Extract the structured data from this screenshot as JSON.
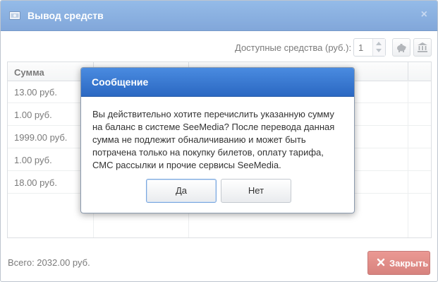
{
  "window": {
    "title": "Вывод средств",
    "close_glyph": "×",
    "icon": "money-icon"
  },
  "toolbar": {
    "available_label": "Доступные средства (руб.):",
    "available_value": "1",
    "btn1_icon": "piggy-bank-icon",
    "btn2_icon": "bank-icon"
  },
  "grid": {
    "columns": [
      "Сумма",
      "",
      ""
    ],
    "rows": [
      [
        "13.00 руб.",
        "",
        ""
      ],
      [
        "1.00 руб.",
        "",
        ""
      ],
      [
        "1999.00 руб.",
        "",
        ""
      ],
      [
        "1.00 руб.",
        "",
        ""
      ],
      [
        "18.00 руб.",
        "",
        ""
      ]
    ]
  },
  "footer": {
    "total": "Всего: 2032.00 руб.",
    "close_label": "Закрыть",
    "close_icon": "close-icon"
  },
  "dialog": {
    "title": "Сообщение",
    "message": "Вы действительно хотите перечислить указанную сумму на баланс в системе SeeMedia? После перевода данная сумма не подлежит обналичиванию и может быть потрачена только на покупку билетов, оплату тарифа, СМС рассылки и прочие сервисы SeeMedia.",
    "yes_label": "Да",
    "no_label": "Нет"
  },
  "colors": {
    "titlebar": "#4a87d5",
    "close_button": "#d4504a"
  }
}
